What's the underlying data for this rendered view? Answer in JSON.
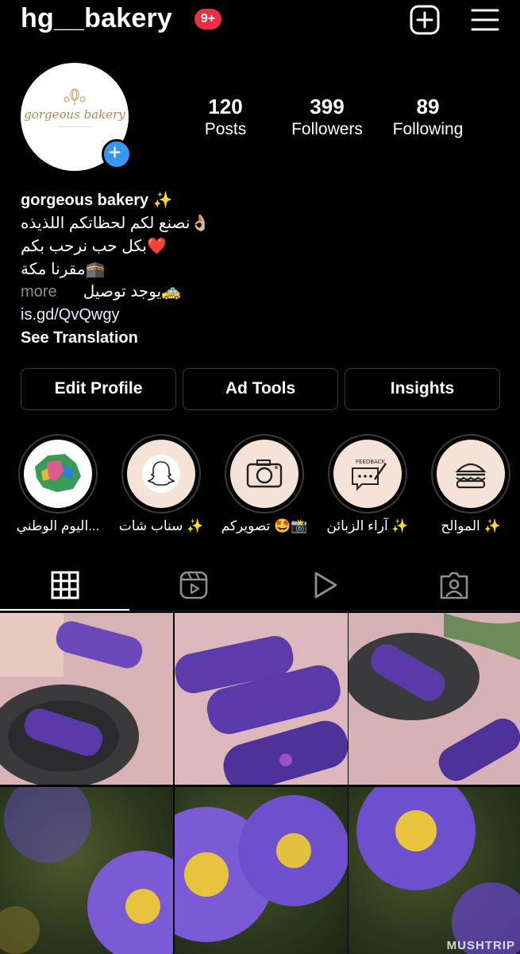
{
  "header": {
    "username": "hg__bakery",
    "notification_badge": "9+"
  },
  "profile": {
    "avatar_logo_text": "gorgeous bakery",
    "stats": [
      {
        "value": "120",
        "label": "Posts"
      },
      {
        "value": "399",
        "label": "Followers"
      },
      {
        "value": "89",
        "label": "Following"
      }
    ]
  },
  "bio": {
    "name": "gorgeous bakery ✨",
    "lines": [
      "نصنع لكم لحظاتكم اللذيذه👌🏼",
      "بكل حب نرحب بكم❤️",
      "مقرنا مكة🕋",
      "يوجد توصيل🚕"
    ],
    "more": "more",
    "link": "is.gd/QvQwgy",
    "see_translation": "See Translation"
  },
  "buttons": {
    "edit_profile": "Edit Profile",
    "ad_tools": "Ad Tools",
    "insights": "Insights"
  },
  "highlights": [
    {
      "label": "اليوم الوطني...",
      "icon": "saudi-map-icon"
    },
    {
      "label": "سناب شات ✨",
      "icon": "snapchat-icon"
    },
    {
      "label": "تصويركم 🤩📸",
      "icon": "camera-icon"
    },
    {
      "label": "آراء الزبائن ✨",
      "icon": "feedback-icon"
    },
    {
      "label": "الموالح ✨",
      "icon": "burger-icon"
    }
  ],
  "tabs": [
    "grid-icon",
    "reels-icon",
    "video-icon",
    "tagged-icon"
  ],
  "grid": {
    "posts": [
      "pastry",
      "pastry",
      "pastry",
      "flower",
      "flower",
      "flower"
    ],
    "watermark": "MUSHTRIP"
  },
  "colors": {
    "badge": "#ed2d44",
    "accent": "#3897f0",
    "pastry_purple": "#5a3aa8",
    "flower_purple": "#7b5ad6"
  }
}
